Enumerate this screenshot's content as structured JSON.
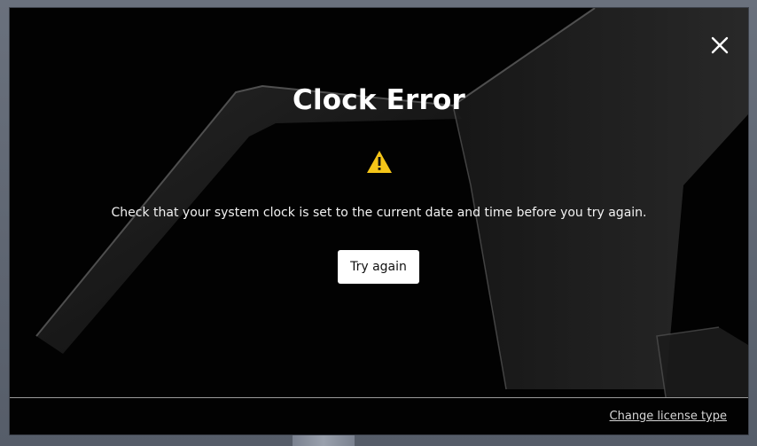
{
  "dialog": {
    "title": "Clock Error",
    "message": "Check that your system clock is set to the current date and time before you try again.",
    "try_again_label": "Try again",
    "footer_link": "Change license type",
    "close_icon": "close-icon",
    "warning_icon": "warning-icon"
  },
  "colors": {
    "dialog_bg": "#030303",
    "warning": "#f5c518",
    "button_bg": "#ffffff",
    "text": "#ffffff"
  }
}
